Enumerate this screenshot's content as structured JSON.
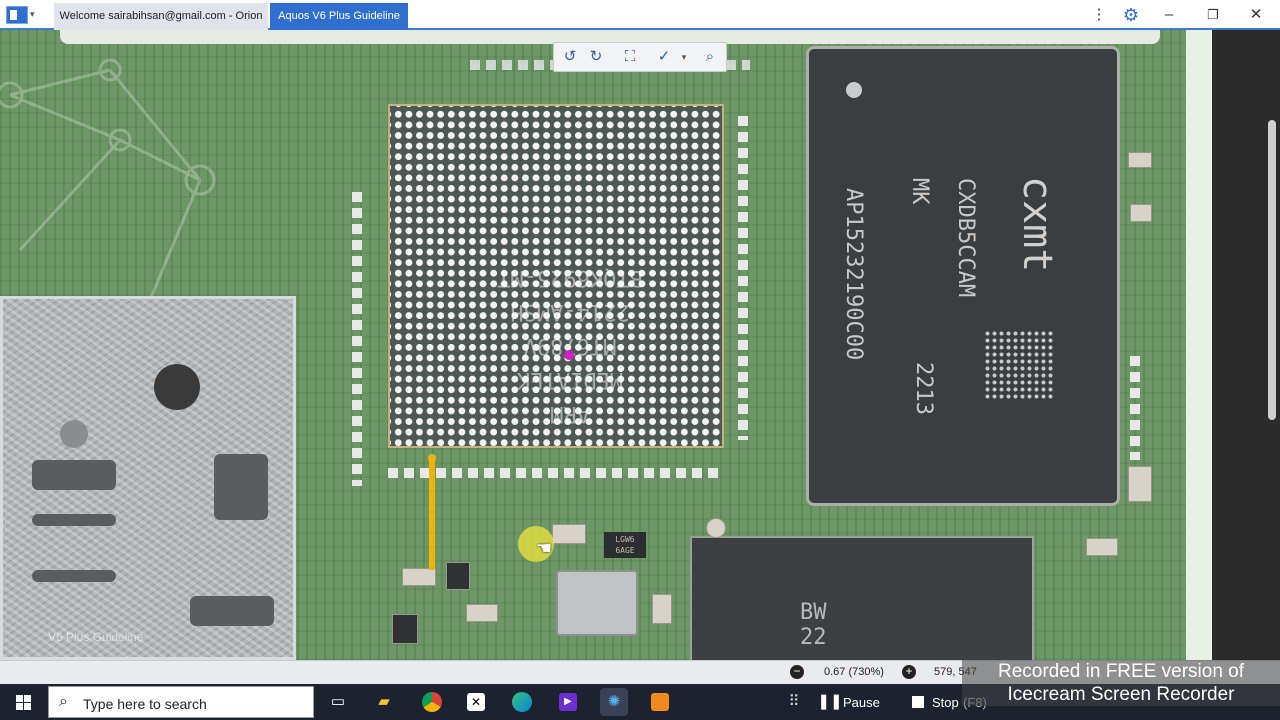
{
  "titlebar": {
    "tabs": [
      {
        "label": "Welcome sairabihsan@gmail.com - Orion",
        "active": false
      },
      {
        "label": "Aquos V6 Plus Guideline",
        "active": true
      }
    ],
    "dropdown_icon": "chevron-down-icon",
    "menu_icon": "kebab-menu-icon",
    "settings_icon": "gear-icon",
    "window_controls": [
      "minimize-icon",
      "maximize-icon",
      "close-icon"
    ]
  },
  "toolbar": {
    "tools": [
      "rotate-left-icon",
      "rotate-right-icon",
      "fit-screen-icon",
      "measure-icon",
      "search-icon"
    ]
  },
  "board": {
    "bga_marking": [
      "ARM",
      "MEDIATEK",
      "MT6789V",
      "2214-AMSH",
      "BTQK6925-MT"
    ],
    "memory": {
      "brand": "cxmt",
      "line1": "CXDB5CCAM",
      "line2": "MK",
      "line3": "AP15232190C00",
      "line4": "2213"
    },
    "small_ic_label": "LGW6\n6AGE",
    "bottom_chip_text": "BW\n22",
    "shield_label": "V6 Plus Guideline"
  },
  "statusbar": {
    "zoom": "0.67 (730%)",
    "coords": "579, 547"
  },
  "watermark": {
    "line1": "Recorded in FREE version of",
    "line2": "Icecream Screen Recorder"
  },
  "taskbar": {
    "search_placeholder": "Type here to search",
    "pause_label": "Pause",
    "stop_label": "Stop",
    "stop_shortcut": "(F8)",
    "apps": [
      "task-view-icon",
      "file-explorer-icon",
      "chrome-icon",
      "app-x-icon",
      "edge-icon",
      "video-app-icon",
      "orion-app-icon",
      "recorder-app-icon"
    ]
  },
  "colors": {
    "accent": "#2f6fcf",
    "board_green": "#6d9766",
    "probe": "#f0b400"
  }
}
